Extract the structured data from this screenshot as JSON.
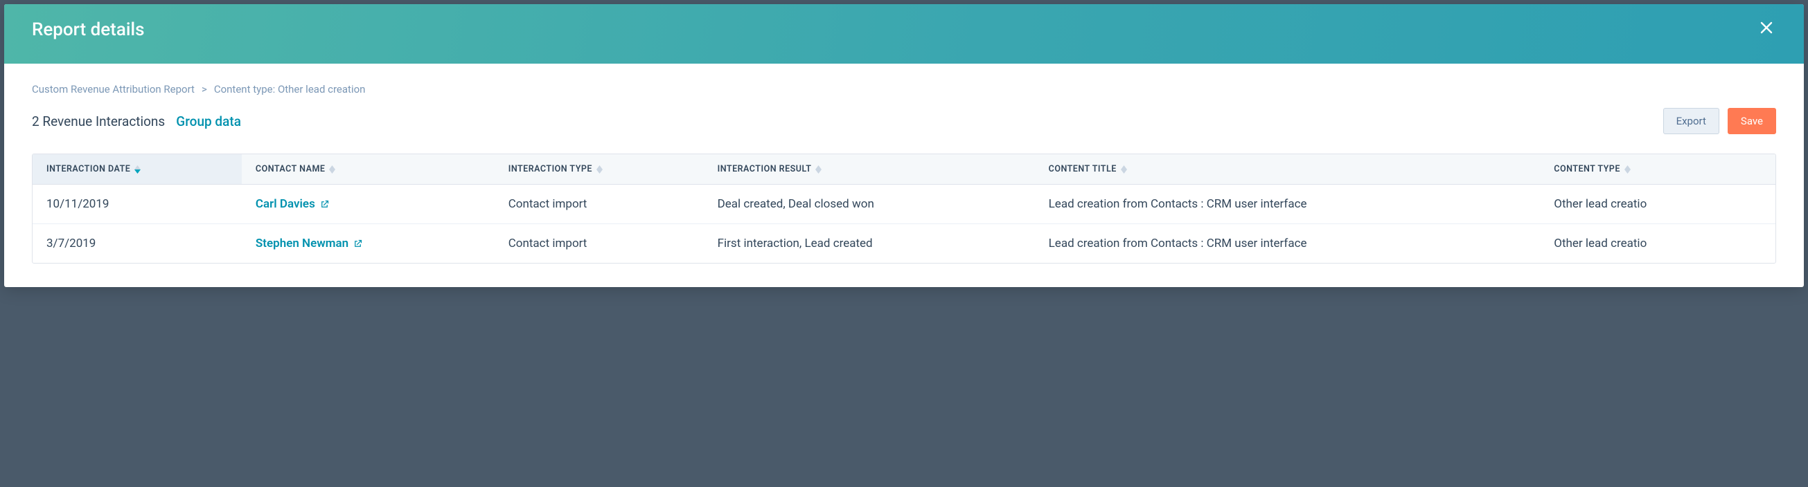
{
  "header": {
    "title": "Report details"
  },
  "breadcrumb": {
    "root": "Custom Revenue Attribution Report",
    "current": "Content type: Other lead creation",
    "separator": ">"
  },
  "toolbar": {
    "count_label": "2 Revenue Interactions",
    "group_data_label": "Group data",
    "export_label": "Export",
    "save_label": "Save"
  },
  "table": {
    "columns": {
      "interaction_date": "INTERACTION DATE",
      "contact_name": "CONTACT NAME",
      "interaction_type": "INTERACTION TYPE",
      "interaction_result": "INTERACTION RESULT",
      "content_title": "CONTENT TITLE",
      "content_type": "CONTENT TYPE"
    },
    "rows": [
      {
        "date": "10/11/2019",
        "contact": "Carl Davies",
        "type": "Contact import",
        "result": "Deal created, Deal closed won",
        "title": "Lead creation from Contacts : CRM user interface",
        "ctype": "Other lead creatio"
      },
      {
        "date": "3/7/2019",
        "contact": "Stephen Newman",
        "type": "Contact import",
        "result": "First interaction, Lead created",
        "title": "Lead creation from Contacts : CRM user interface",
        "ctype": "Other lead creatio"
      }
    ]
  },
  "colors": {
    "teal_link": "#0091ae",
    "orange": "#ff7a53",
    "header_grad_start": "#4fb6a9",
    "header_grad_end": "#2e9fb2"
  }
}
